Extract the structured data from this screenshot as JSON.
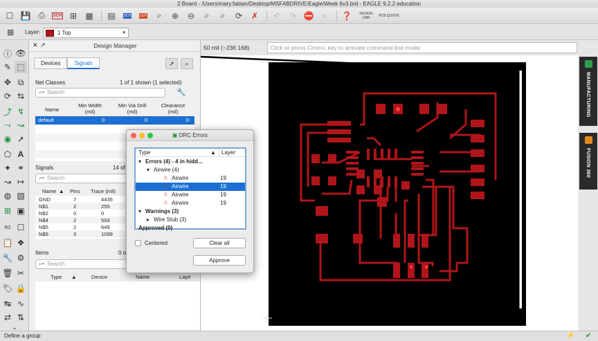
{
  "window_title": "2 Board - /Users/mary.fabian/Desktop/MSFABDRIVE/Eagle/Week 6v3.brd - EAGLE 9.2.2 education",
  "toolbar": {
    "design_link": "DESIGN LINK",
    "pcb_quote": "PCB QUOTE",
    "sch_label": "SCH",
    "ulp_label": "ULP"
  },
  "layer_bar": {
    "label": "Layer:",
    "selected": "1 Top",
    "swatch_color": "#b0151a"
  },
  "design_manager": {
    "title": "Design Manager",
    "tabs": [
      "Devices",
      "Signals"
    ],
    "active_tab": "Signals",
    "net_classes": {
      "label": "Net Classes",
      "count": "1 of 1 shown (1 selected)",
      "search_placeholder": "Search",
      "headers": [
        "Name",
        "Min Width (mil)",
        "Min Via Drill (mil)",
        "Clearance (mil)"
      ],
      "rows": [
        [
          "default",
          "0",
          "0",
          "0"
        ]
      ]
    },
    "signals": {
      "label": "Signals",
      "count": "14 of",
      "search_placeholder": "Search",
      "headers": [
        "Name",
        "Pins",
        "Trace (mil)"
      ],
      "rows": [
        [
          "GND",
          "7",
          "4435"
        ],
        [
          "N$1",
          "2",
          "255"
        ],
        [
          "N$2",
          "0",
          "0"
        ],
        [
          "N$4",
          "2",
          "593"
        ],
        [
          "N$5",
          "2",
          "649"
        ],
        [
          "N$6",
          "3",
          "1099"
        ]
      ]
    },
    "items": {
      "label": "Items",
      "count": "0 o",
      "search_placeholder": "Search",
      "headers": [
        "Type",
        "Device",
        "Name",
        "Laye"
      ]
    }
  },
  "canvas": {
    "coordinate": "50 mil (−236 168)",
    "command_placeholder": "Click or press Cmd+L key to activate command line mode"
  },
  "right_panel": [
    "MANUFACTURING",
    "FUSION 360"
  ],
  "drc": {
    "title": "DRC Errors",
    "col_type": "Type",
    "col_layer": "Layer",
    "rows": [
      {
        "text": "Errors (4) - 4 in hidd...",
        "layer": "",
        "indent": 0,
        "arrow": "▾",
        "bold": true
      },
      {
        "text": "Airwire (4)",
        "layer": "",
        "indent": 1,
        "arrow": "▾",
        "bold": false
      },
      {
        "text": "Airwire",
        "layer": "19",
        "indent": 2,
        "arrow": "",
        "bold": false
      },
      {
        "text": "Airwire",
        "layer": "19",
        "indent": 2,
        "arrow": "",
        "bold": false,
        "selected": true
      },
      {
        "text": "Airwire",
        "layer": "19",
        "indent": 2,
        "arrow": "",
        "bold": false
      },
      {
        "text": "Airwire",
        "layer": "19",
        "indent": 2,
        "arrow": "",
        "bold": false
      },
      {
        "text": "Warnings (3)",
        "layer": "",
        "indent": 0,
        "arrow": "▾",
        "bold": true
      },
      {
        "text": "Wire Stub (3)",
        "layer": "",
        "indent": 1,
        "arrow": "▸",
        "bold": false
      },
      {
        "text": "Approved (0)",
        "layer": "",
        "indent": 0,
        "arrow": "",
        "bold": true
      }
    ],
    "centered_label": "Centered",
    "clear_all": "Clear all",
    "approve": "Approve"
  },
  "status": {
    "text": "Define a group"
  }
}
